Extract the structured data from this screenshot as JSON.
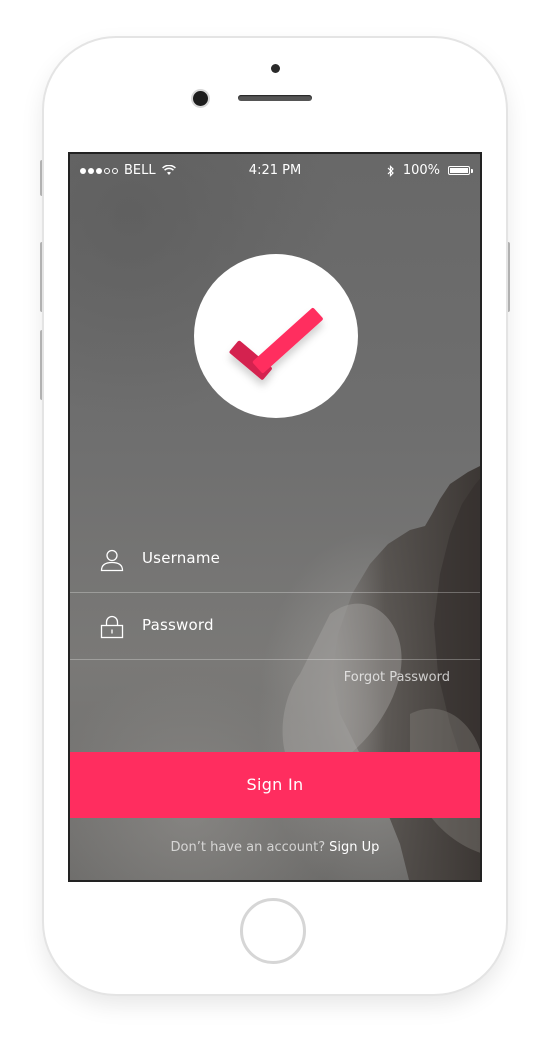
{
  "status_bar": {
    "carrier": "BELL",
    "time": "4:21 PM",
    "battery": "100%",
    "signal_icon": "signal-dots-icon",
    "wifi_icon": "wifi-icon",
    "bluetooth_icon": "bluetooth-icon",
    "battery_icon": "battery-icon"
  },
  "logo": {
    "icon": "checkmark-icon",
    "accent": "#ff2d5f"
  },
  "form": {
    "username_label": "Username",
    "username_icon": "user-icon",
    "password_label": "Password",
    "password_icon": "lock-icon",
    "forgot_label": "Forgot Password"
  },
  "actions": {
    "signin_label": "Sign In",
    "signin_color": "#ff2d5f"
  },
  "footer": {
    "question": "Don’t have an account?",
    "signup_label": "Sign Up"
  }
}
